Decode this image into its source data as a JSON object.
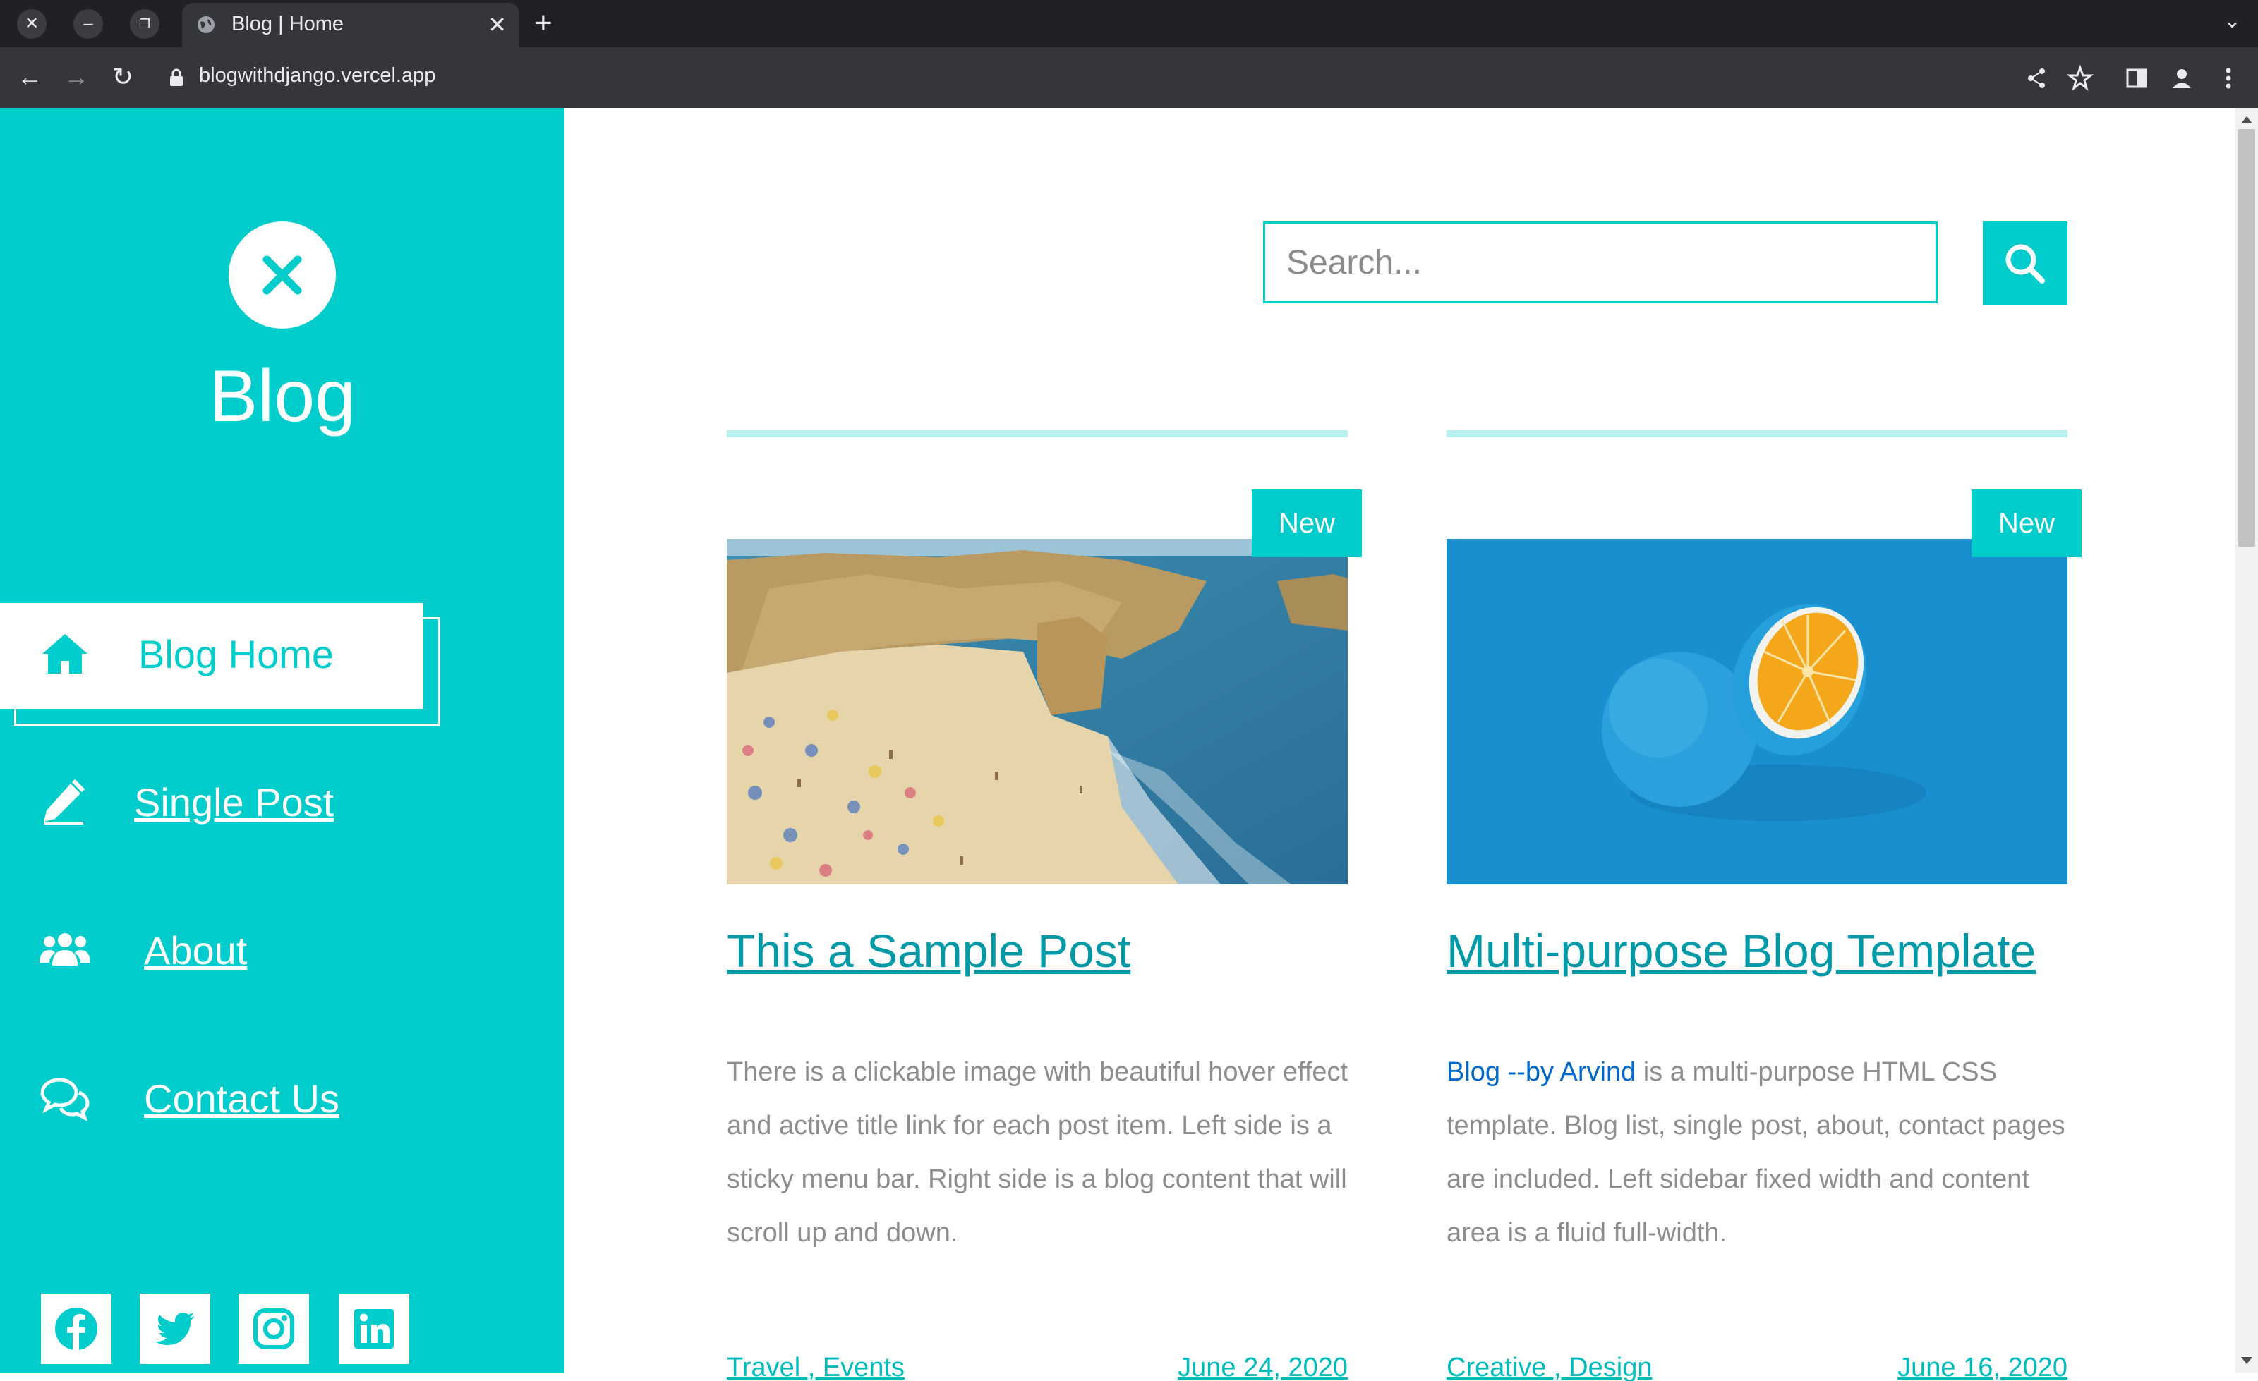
{
  "browser": {
    "tab_title": "Blog | Home",
    "url": "blogwithdjango.vercel.app"
  },
  "sidebar": {
    "site_title": "Blog",
    "nav": [
      {
        "label": "Blog Home",
        "icon": "home-icon",
        "active": true
      },
      {
        "label": "Single Post",
        "icon": "pen-icon"
      },
      {
        "label": "About",
        "icon": "users-icon"
      },
      {
        "label": "Contact Us",
        "icon": "comments-icon"
      }
    ],
    "social": [
      "facebook-icon",
      "twitter-icon",
      "instagram-icon",
      "linkedin-icon"
    ]
  },
  "search": {
    "placeholder": "Search..."
  },
  "posts": [
    {
      "badge": "New",
      "title": "This a Sample Post",
      "excerpt": "There is a clickable image with beautiful hover effect and active title link for each post item. Left side is a sticky menu bar. Right side is a blog content that will scroll up and down.",
      "tags": "Travel , Events",
      "date": "June 24, 2020"
    },
    {
      "badge": "New",
      "title": "Multi-purpose Blog Template",
      "excerpt_link": "Blog --by Arvind",
      "excerpt_rest": " is a multi-purpose HTML CSS template. Blog list, single post, about, contact pages are included. Left sidebar fixed width and content area is a fluid full-width.",
      "tags": "Creative , Design",
      "date": "June 16, 2020"
    }
  ],
  "colors": {
    "accent": "#00cccc",
    "title_link": "#0099a8",
    "rule": "#b8efef"
  }
}
